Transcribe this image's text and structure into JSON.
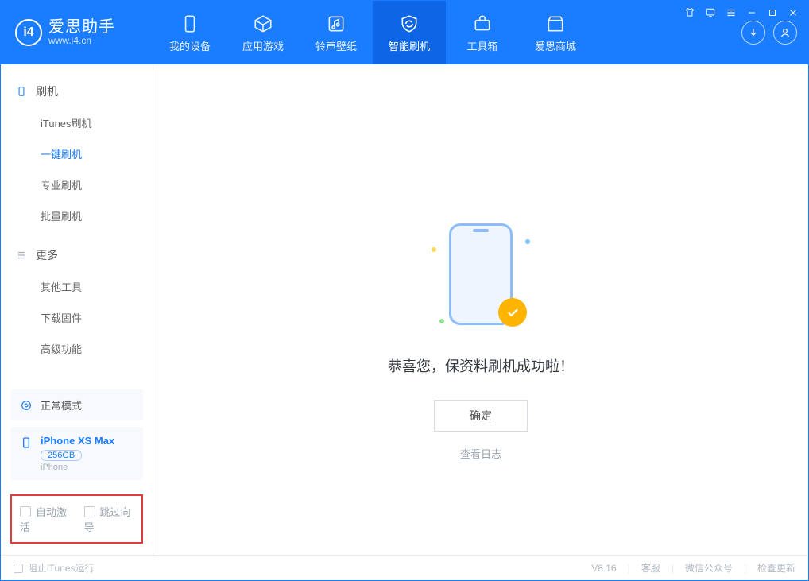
{
  "app": {
    "title": "爱思助手",
    "subtitle": "www.i4.cn"
  },
  "nav": {
    "tabs": [
      {
        "id": "device",
        "label": "我的设备"
      },
      {
        "id": "apps",
        "label": "应用游戏"
      },
      {
        "id": "media",
        "label": "铃声壁纸"
      },
      {
        "id": "flash",
        "label": "智能刷机"
      },
      {
        "id": "toolbox",
        "label": "工具箱"
      },
      {
        "id": "store",
        "label": "爱思商城"
      }
    ],
    "active": "flash"
  },
  "sidebar": {
    "groups": [
      {
        "id": "flash",
        "title": "刷机",
        "items": [
          {
            "id": "itunes",
            "label": "iTunes刷机"
          },
          {
            "id": "onekey",
            "label": "一键刷机"
          },
          {
            "id": "pro",
            "label": "专业刷机"
          },
          {
            "id": "batch",
            "label": "批量刷机"
          }
        ],
        "active": "onekey"
      },
      {
        "id": "more",
        "title": "更多",
        "items": [
          {
            "id": "other",
            "label": "其他工具"
          },
          {
            "id": "firmware",
            "label": "下载固件"
          },
          {
            "id": "advanced",
            "label": "高级功能"
          }
        ]
      }
    ]
  },
  "device": {
    "mode_label": "正常模式",
    "name": "iPhone XS Max",
    "capacity": "256GB",
    "type": "iPhone"
  },
  "options": {
    "auto_activate_label": "自动激活",
    "skip_guide_label": "跳过向导"
  },
  "main": {
    "success_message": "恭喜您，保资料刷机成功啦！",
    "ok_label": "确定",
    "view_log_label": "查看日志"
  },
  "status": {
    "block_itunes_label": "阻止iTunes运行",
    "version": "V8.16",
    "links": {
      "support": "客服",
      "wechat": "微信公众号",
      "update": "检查更新"
    }
  }
}
